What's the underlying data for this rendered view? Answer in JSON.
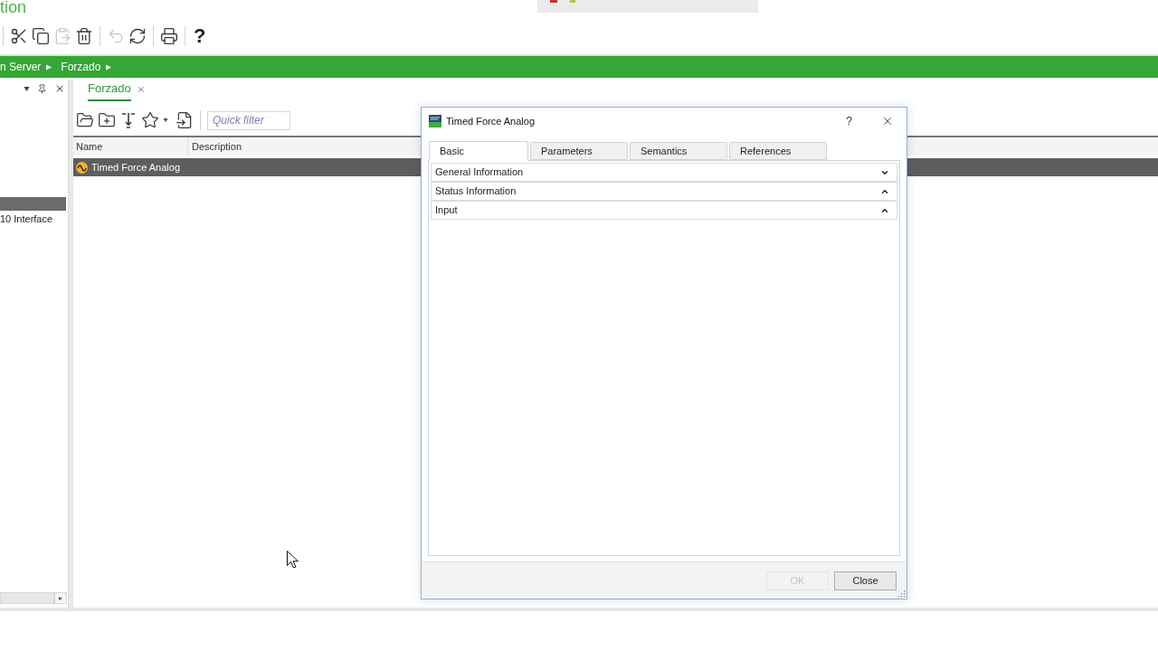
{
  "app_title": "tion",
  "toolbar": [
    {
      "kind": "cut",
      "disabled": false
    },
    {
      "kind": "copy",
      "disabled": false
    },
    {
      "kind": "paste",
      "disabled": true
    },
    {
      "kind": "delete",
      "disabled": false
    },
    {
      "kind": "undo",
      "disabled": true
    },
    {
      "kind": "refresh",
      "disabled": false
    },
    {
      "kind": "print",
      "disabled": false
    },
    {
      "kind": "help",
      "label": "?",
      "disabled": false
    }
  ],
  "breadcrumb": [
    {
      "label": "n Server"
    },
    {
      "label": "Forzado"
    }
  ],
  "side_panel": {
    "items": [
      {
        "selected": true
      },
      {
        "label": "10 Interface",
        "selected": false
      }
    ]
  },
  "tabs": [
    {
      "label": "Forzado",
      "selected": true
    }
  ],
  "search": {
    "placeholder": "Quick filter"
  },
  "table": {
    "columns": [
      "Name",
      "Description"
    ],
    "rows": [
      {
        "name": "Timed Force Analog",
        "selected": true
      }
    ]
  },
  "dialog": {
    "title": "Timed Force Analog",
    "help_label": "?",
    "tabs": [
      {
        "label": "Basic",
        "selected": true
      },
      {
        "label": "Parameters",
        "selected": false
      },
      {
        "label": "Semantics",
        "selected": false
      },
      {
        "label": "References",
        "selected": false
      }
    ],
    "sections": [
      {
        "label": "General Information",
        "expanded": false
      },
      {
        "label": "Status Information",
        "expanded": true
      },
      {
        "label": "Input",
        "expanded": true
      }
    ],
    "buttons": [
      {
        "label": "OK",
        "disabled": true
      },
      {
        "label": "Close",
        "disabled": false
      }
    ]
  }
}
